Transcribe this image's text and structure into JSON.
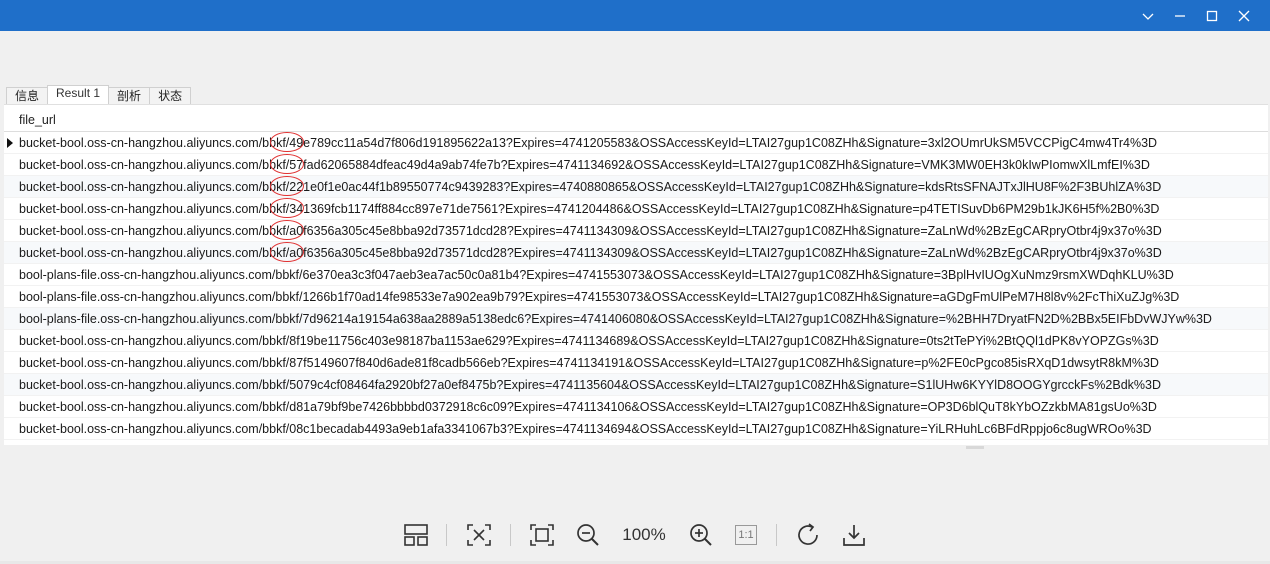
{
  "window": {
    "controls": [
      "chevron-down-icon",
      "minimize-icon",
      "maximize-icon",
      "close-icon"
    ]
  },
  "tabs": [
    "信息",
    "Result 1",
    "剖析",
    "状态"
  ],
  "grid": {
    "column": "file_url",
    "rows": [
      "bucket-bool.oss-cn-hangzhou.aliyuncs.com/bbkf/49e789cc11a54d7f806d191895622a13?Expires=4741205583&OSSAccessKeyId=LTAI27gup1C08ZHh&Signature=3xl2OUmrUkSM5VCCPigC4mw4Tr4%3D",
      "bucket-bool.oss-cn-hangzhou.aliyuncs.com/bbkf/57fad62065884dfeac49d4a9ab74fe7b?Expires=4741134692&OSSAccessKeyId=LTAI27gup1C08ZHh&Signature=VMK3MW0EH3k0kIwPIomwXlLmfEI%3D",
      "bucket-bool.oss-cn-hangzhou.aliyuncs.com/bbkf/221e0f1e0ac44f1b89550774c9439283?Expires=4740880865&OSSAccessKeyId=LTAI27gup1C08ZHh&Signature=kdsRtsSFNAJTxJlHU8F%2F3BUhlZA%3D",
      "bucket-bool.oss-cn-hangzhou.aliyuncs.com/bbkf/341369fcb1174ff884cc897e71de7561?Expires=4741204486&OSSAccessKeyId=LTAI27gup1C08ZHh&Signature=p4TETISuvDb6PM29b1kJK6H5f%2B0%3D",
      "bucket-bool.oss-cn-hangzhou.aliyuncs.com/bbkf/a0f6356a305c45e8bba92d73571dcd28?Expires=4741134309&OSSAccessKeyId=LTAI27gup1C08ZHh&Signature=ZaLnWd%2BzEgCARpryOtbr4j9x37o%3D",
      "bucket-bool.oss-cn-hangzhou.aliyuncs.com/bbkf/a0f6356a305c45e8bba92d73571dcd28?Expires=4741134309&OSSAccessKeyId=LTAI27gup1C08ZHh&Signature=ZaLnWd%2BzEgCARpryOtbr4j9x37o%3D",
      "bool-plans-file.oss-cn-hangzhou.aliyuncs.com/bbkf/6e370ea3c3f047aeb3ea7ac50c0a81b4?Expires=4741553073&OSSAccessKeyId=LTAI27gup1C08ZHh&Signature=3BplHvIUOgXuNmz9rsmXWDqhKLU%3D",
      "bool-plans-file.oss-cn-hangzhou.aliyuncs.com/bbkf/1266b1f70ad14fe98533e7a902ea9b79?Expires=4741553073&OSSAccessKeyId=LTAI27gup1C08ZHh&Signature=aGDgFmUlPeM7H8l8v%2FcThiXuZJg%3D",
      "bool-plans-file.oss-cn-hangzhou.aliyuncs.com/bbkf/7d96214a19154a638aa2889a5138edc6?Expires=4741406080&OSSAccessKeyId=LTAI27gup1C08ZHh&Signature=%2BHH7DryatFN2D%2BBx5EIFbDvWJYw%3D",
      "bucket-bool.oss-cn-hangzhou.aliyuncs.com/bbkf/8f19be11756c403e98187ba1153ae629?Expires=4741134689&OSSAccessKeyId=LTAI27gup1C08ZHh&Signature=0ts2tTePYi%2BtQQl1dPK8vYOPZGs%3D",
      "bucket-bool.oss-cn-hangzhou.aliyuncs.com/bbkf/87f5149607f840d6ade81f8cadb566eb?Expires=4741134191&OSSAccessKeyId=LTAI27gup1C08ZHh&Signature=p%2FE0cPgco85isRXqD1dwsytR8kM%3D",
      "bucket-bool.oss-cn-hangzhou.aliyuncs.com/bbkf/5079c4cf08464fa2920bf27a0ef8475b?Expires=4741135604&OSSAccessKeyId=LTAI27gup1C08ZHh&Signature=S1lUHw6KYYlD8OOGYgrcckFs%2Bdk%3D",
      "bucket-bool.oss-cn-hangzhou.aliyuncs.com/bbkf/d81a79bf9be7426bbbbd0372918c6c09?Expires=4741134106&OSSAccessKeyId=LTAI27gup1C08ZHh&Signature=OP3D6blQuT8kYbOZzkbMA81gsUo%3D",
      "bucket-bool.oss-cn-hangzhou.aliyuncs.com/bbkf/08c1becadab4493a9eb1afa3341067b3?Expires=4741134694&OSSAccessKeyId=LTAI27gup1C08ZHh&Signature=YiLRHuhLc6BFdRppjo6c8ugWROo%3D"
    ]
  },
  "viewer_toolbar": {
    "zoom": "100%",
    "actual_size_label": "1:1",
    "icons": [
      "layout-icon",
      "fit-screen-icon",
      "fullscreen-icon",
      "zoom-out-icon",
      "zoom-in-icon",
      "actual-size-icon",
      "rotate-icon",
      "download-icon"
    ]
  },
  "colors": {
    "titlebar": "#1f6fc9",
    "annotation": "#e03030"
  }
}
